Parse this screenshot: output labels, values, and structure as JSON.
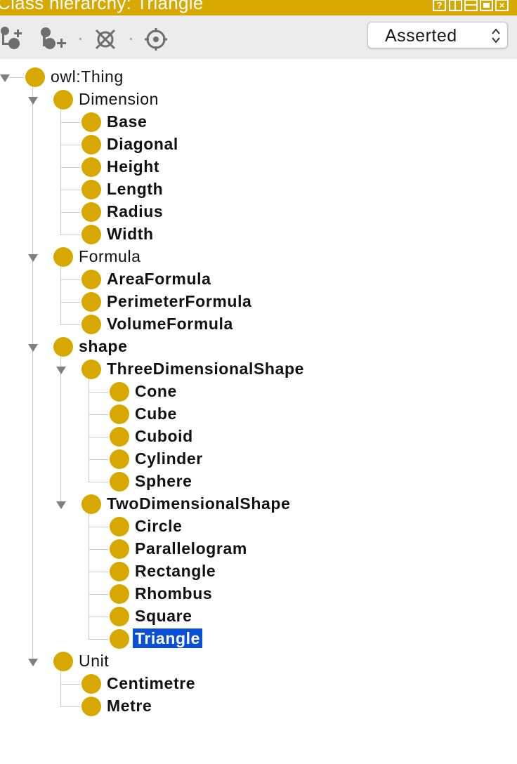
{
  "window": {
    "title": "Class hierarchy: Triangle",
    "buttons": [
      "?",
      "",
      "",
      "",
      "×"
    ]
  },
  "toolbar": {
    "icons": [
      "add-subclass-icon",
      "add-sibling-class-icon",
      "delete-class-icon",
      "find-class-icon"
    ],
    "view_select": "Asserted"
  },
  "tree": [
    {
      "label": "owl:Thing",
      "bold": false,
      "expanded": true
    },
    {
      "label": "Dimension",
      "bold": false,
      "expanded": true
    },
    {
      "label": "Base",
      "bold": true
    },
    {
      "label": "Diagonal",
      "bold": true
    },
    {
      "label": "Height",
      "bold": true
    },
    {
      "label": "Length",
      "bold": true
    },
    {
      "label": "Radius",
      "bold": true
    },
    {
      "label": "Width",
      "bold": true
    },
    {
      "label": "Formula",
      "bold": false,
      "expanded": true
    },
    {
      "label": "AreaFormula",
      "bold": true
    },
    {
      "label": "PerimeterFormula",
      "bold": true
    },
    {
      "label": "VolumeFormula",
      "bold": true
    },
    {
      "label": "shape",
      "bold": true,
      "expanded": true
    },
    {
      "label": "ThreeDimensionalShape",
      "bold": true,
      "expanded": true
    },
    {
      "label": "Cone",
      "bold": true
    },
    {
      "label": "Cube",
      "bold": true
    },
    {
      "label": "Cuboid",
      "bold": true
    },
    {
      "label": "Cylinder",
      "bold": true
    },
    {
      "label": "Sphere",
      "bold": true
    },
    {
      "label": "TwoDimensionalShape",
      "bold": true,
      "expanded": true
    },
    {
      "label": "Circle",
      "bold": true
    },
    {
      "label": "Parallelogram",
      "bold": true
    },
    {
      "label": "Rectangle",
      "bold": true
    },
    {
      "label": "Rhombus",
      "bold": true
    },
    {
      "label": "Square",
      "bold": true
    },
    {
      "label": "Triangle",
      "bold": true,
      "selected": true
    },
    {
      "label": "Unit",
      "bold": false,
      "expanded": true
    },
    {
      "label": "Centimetre",
      "bold": true
    },
    {
      "label": "Metre",
      "bold": true
    }
  ],
  "colors": {
    "accent": "#d6a800",
    "selection": "#0a50d6",
    "toolbar_bg": "#ececec"
  }
}
